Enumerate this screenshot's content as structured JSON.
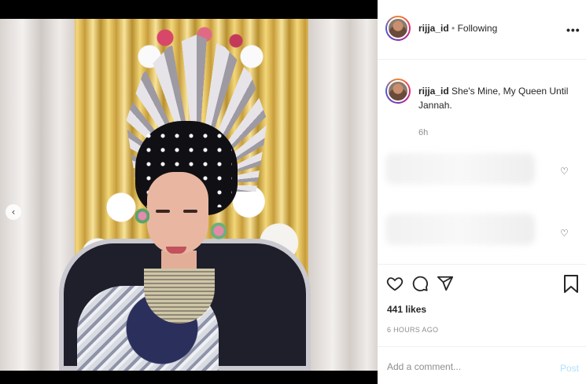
{
  "header": {
    "username": "rijja_id",
    "separator": "•",
    "follow_status": "Following",
    "more_label": "•••"
  },
  "caption": {
    "username": "rijja_id",
    "text": "She's Mine, My Queen Until Jannah.",
    "time": "6h"
  },
  "comments": [
    {
      "like_icon": "heart-outline-icon"
    },
    {
      "like_icon": "heart-outline-icon"
    }
  ],
  "actions": {
    "icons": [
      "heart-icon",
      "comment-icon",
      "share-icon",
      "bookmark-icon"
    ],
    "likes": "441 likes",
    "timestamp": "6 HOURS AGO"
  },
  "comment_box": {
    "placeholder": "Add a comment...",
    "post_label": "Post"
  },
  "photo": {
    "prev_icon": "chevron-left-icon"
  },
  "colors": {
    "post_button": "#b2dffc",
    "text": "#262626",
    "muted": "#8e8e8e"
  }
}
